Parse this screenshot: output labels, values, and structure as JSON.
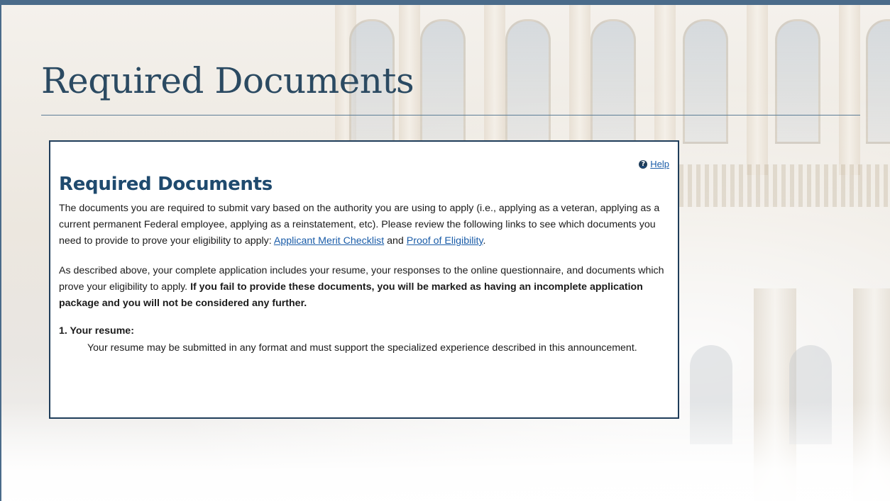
{
  "slide": {
    "title": "Required Documents"
  },
  "panel": {
    "help_label": "Help",
    "heading": "Required Documents",
    "para1": {
      "text_before": "The documents you are required to submit vary based on the authority you are using to apply (i.e., applying as a veteran, applying as a current permanent Federal employee, applying as a reinstatement, etc). Please review the following links to see which documents you need to provide to prove your eligibility to apply: ",
      "link1": "Applicant Merit Checklist",
      "text_between": " and ",
      "link2": "Proof of Eligibility",
      "text_after": "."
    },
    "para2": {
      "text": "As described above, your complete application includes your resume, your responses to the online questionnaire, and documents which prove your eligibility to apply. ",
      "bold": "If you fail to provide these documents, you will be marked as having an incomplete application package and you will not be considered any further."
    },
    "section1": {
      "heading": "1. Your resume:",
      "body": "Your resume may be submitted in any format and must support the specialized experience described in this announcement."
    }
  },
  "colors": {
    "title": "#2b4a62",
    "heading": "#1f4a6e",
    "link": "#1a5ca8",
    "panel_border": "#1f3d5a",
    "slide_border": "#4a6b8a"
  },
  "icons": {
    "help": "question-circle-icon"
  }
}
